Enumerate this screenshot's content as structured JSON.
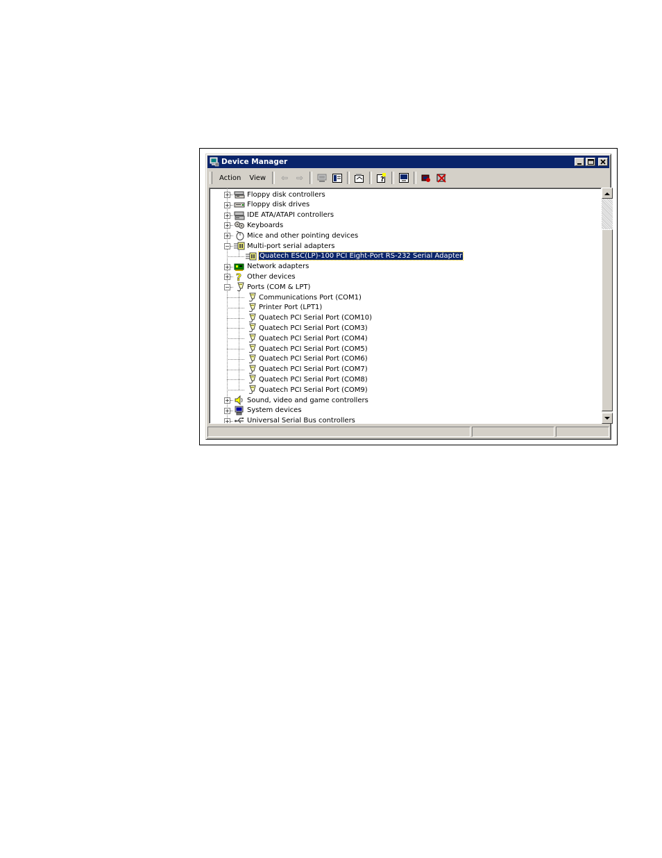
{
  "window": {
    "title": "Device Manager"
  },
  "toolbar": {
    "menus": [
      {
        "label": "Action"
      },
      {
        "label": "View"
      }
    ],
    "icons": [
      "back-arrow-icon",
      "forward-arrow-icon",
      "computer-icon",
      "device-view-icon",
      "properties-icon",
      "help-icon",
      "scan-hardware-icon",
      "disable-device-icon",
      "uninstall-device-icon"
    ]
  },
  "tree": {
    "items": [
      {
        "label": "Floppy disk controllers",
        "level": 0,
        "expander": "+",
        "icon": "floppy-controller-icon"
      },
      {
        "label": "Floppy disk drives",
        "level": 0,
        "expander": "+",
        "icon": "floppy-drive-icon"
      },
      {
        "label": "IDE ATA/ATAPI controllers",
        "level": 0,
        "expander": "+",
        "icon": "ide-controller-icon"
      },
      {
        "label": "Keyboards",
        "level": 0,
        "expander": "+",
        "icon": "keyboard-icon"
      },
      {
        "label": "Mice and other pointing devices",
        "level": 0,
        "expander": "+",
        "icon": "mouse-icon"
      },
      {
        "label": "Multi-port serial adapters",
        "level": 0,
        "expander": "-",
        "icon": "multiport-serial-icon"
      },
      {
        "label": "Quatech ESC(LP)-100 PCI Eight-Port RS-232 Serial Adapter",
        "level": 1,
        "expander": "",
        "icon": "multiport-serial-icon",
        "selected": true
      },
      {
        "label": "Network adapters",
        "level": 0,
        "expander": "+",
        "icon": "network-adapter-icon"
      },
      {
        "label": "Other devices",
        "level": 0,
        "expander": "+",
        "icon": "question-mark-icon"
      },
      {
        "label": "Ports (COM & LPT)",
        "level": 0,
        "expander": "-",
        "icon": "port-icon"
      },
      {
        "label": "Communications Port (COM1)",
        "level": 1,
        "expander": "",
        "icon": "port-icon"
      },
      {
        "label": "Printer Port (LPT1)",
        "level": 1,
        "expander": "",
        "icon": "port-icon"
      },
      {
        "label": "Quatech PCI Serial Port (COM10)",
        "level": 1,
        "expander": "",
        "icon": "port-icon"
      },
      {
        "label": "Quatech PCI Serial Port (COM3)",
        "level": 1,
        "expander": "",
        "icon": "port-icon"
      },
      {
        "label": "Quatech PCI Serial Port (COM4)",
        "level": 1,
        "expander": "",
        "icon": "port-icon"
      },
      {
        "label": "Quatech PCI Serial Port (COM5)",
        "level": 1,
        "expander": "",
        "icon": "port-icon"
      },
      {
        "label": "Quatech PCI Serial Port (COM6)",
        "level": 1,
        "expander": "",
        "icon": "port-icon"
      },
      {
        "label": "Quatech PCI Serial Port (COM7)",
        "level": 1,
        "expander": "",
        "icon": "port-icon"
      },
      {
        "label": "Quatech PCI Serial Port (COM8)",
        "level": 1,
        "expander": "",
        "icon": "port-icon"
      },
      {
        "label": "Quatech PCI Serial Port (COM9)",
        "level": 1,
        "expander": "",
        "icon": "port-icon"
      },
      {
        "label": "Sound, video and game controllers",
        "level": 0,
        "expander": "+",
        "icon": "speaker-icon"
      },
      {
        "label": "System devices",
        "level": 0,
        "expander": "+",
        "icon": "system-devices-icon"
      },
      {
        "label": "Universal Serial Bus controllers",
        "level": 0,
        "expander": "+",
        "icon": "usb-icon"
      }
    ]
  },
  "colors": {
    "titlebar": "#0a246a",
    "selection": "#0a246a",
    "face": "#d4d0c8"
  }
}
